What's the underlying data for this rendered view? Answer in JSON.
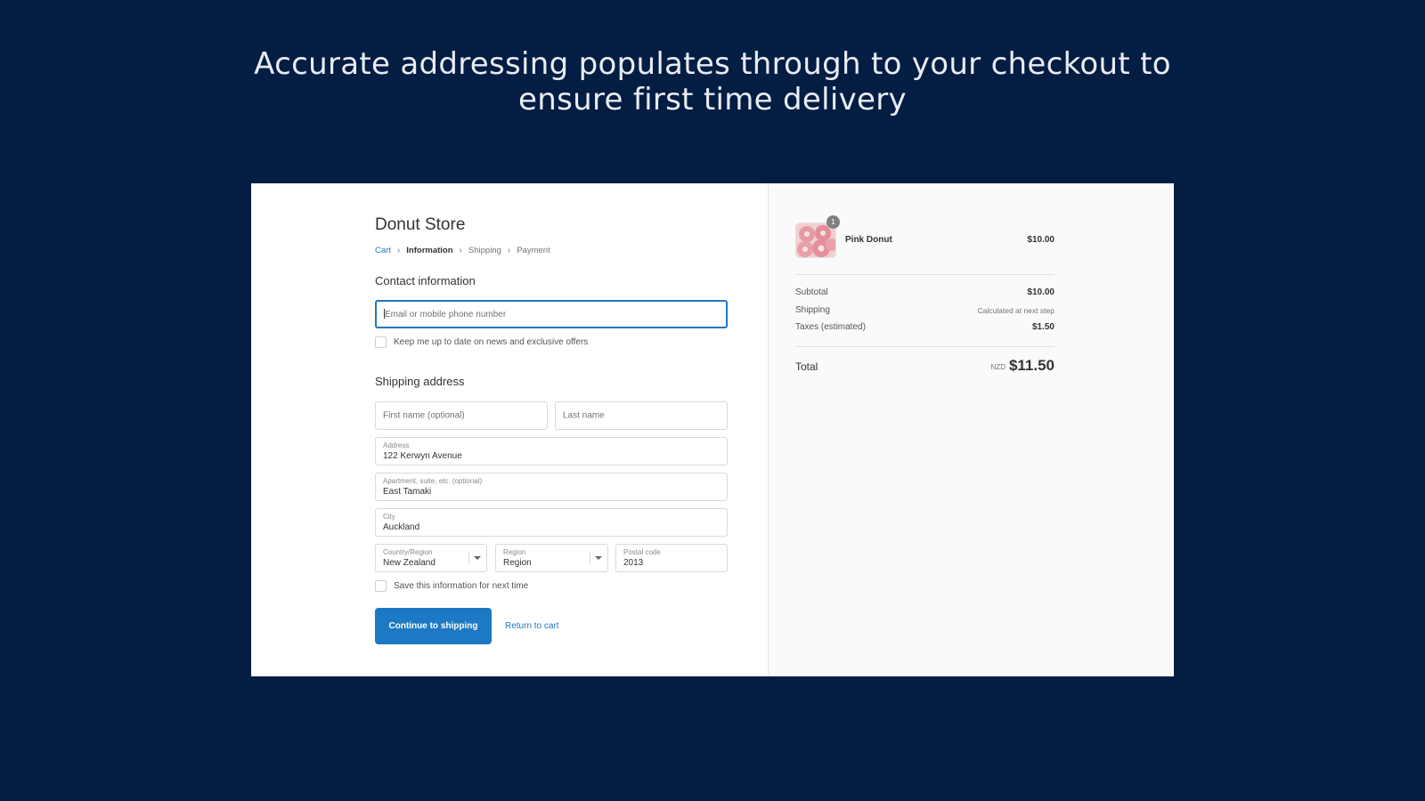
{
  "headline": {
    "line1": "Accurate addressing populates through to your checkout to",
    "line2": "ensure first time delivery"
  },
  "colors": {
    "background": "#041d42",
    "accent": "#1d79c4",
    "link": "#1f77c2"
  },
  "store": {
    "name": "Donut Store"
  },
  "breadcrumb": {
    "items": [
      "Cart",
      "Information",
      "Shipping",
      "Payment"
    ],
    "current": "Information"
  },
  "contact": {
    "title": "Contact information",
    "email_placeholder": "Email or mobile phone number",
    "newsletter_label": "Keep me up to date on news and exclusive offers"
  },
  "shipping": {
    "title": "Shipping address",
    "first_name_placeholder": "First name (optional)",
    "last_name_placeholder": "Last name",
    "address": {
      "label": "Address",
      "value": "122 Kerwyn Avenue"
    },
    "apartment": {
      "label": "Apartment, suite, etc. (optional)",
      "value": "East Tamaki"
    },
    "city": {
      "label": "City",
      "value": "Auckland"
    },
    "country": {
      "label": "Country/Region",
      "value": "New Zealand"
    },
    "region": {
      "label": "Region",
      "value": "Region"
    },
    "postal": {
      "label": "Postal code",
      "value": "2013"
    },
    "save_label": "Save this information for next time"
  },
  "actions": {
    "continue_label": "Continue to shipping",
    "return_label": "Return to cart"
  },
  "order": {
    "product": {
      "name": "Pink Donut",
      "price": "$10.00",
      "quantity": "1"
    },
    "subtotal": {
      "label": "Subtotal",
      "value": "$10.00"
    },
    "shipping": {
      "label": "Shipping",
      "value": "Calculated at next step"
    },
    "taxes": {
      "label": "Taxes (estimated)",
      "value": "$1.50"
    },
    "total": {
      "label": "Total",
      "currency": "NZD",
      "value": "$11.50"
    }
  }
}
